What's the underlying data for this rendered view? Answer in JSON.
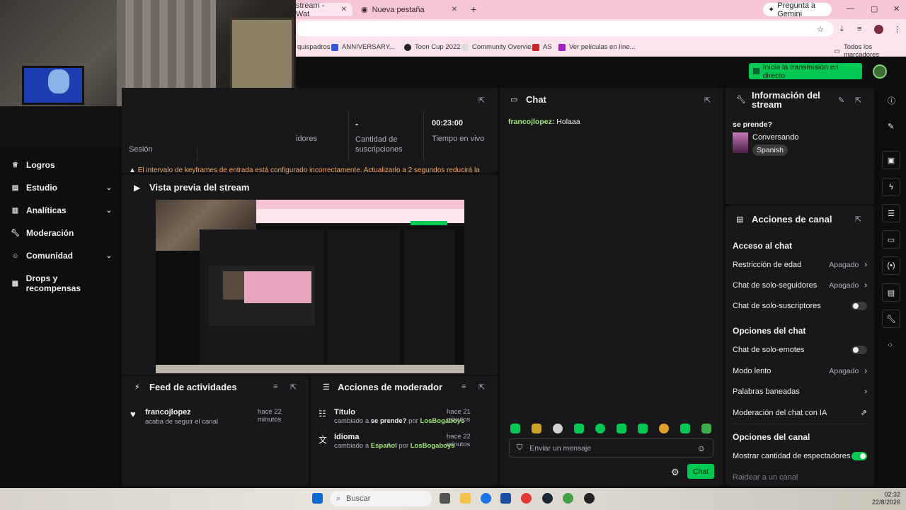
{
  "browser": {
    "tabs": [
      {
        "title": "stream - Wat",
        "active": true
      },
      {
        "title": "Nueva pestaña",
        "active": false
      }
    ],
    "gemini_label": "Pregunta a Gemini",
    "bookmarks": [
      "quispadros",
      "ANNIVERSARY...",
      "Toon Cup 2022",
      "Community Overvie...",
      "AS",
      "Ver películas en líne..."
    ],
    "all_bookmarks": "Todos los marcadores"
  },
  "header": {
    "go_live_label": "Inicia la transmisión en directo"
  },
  "stats": {
    "session_label": "Sesión",
    "followers_label": "idores",
    "subs_value": "-",
    "subs_label": "Cantidad de suscripciones",
    "live_time_value": "00:23:00",
    "live_time_label": "Tiempo en vivo",
    "warning": "El intervalo de keyframes de entrada está configurado incorrectamente. Actualizarlo a 2 segundos reducirá la"
  },
  "sidebar": {
    "items": [
      {
        "label": "Logros",
        "icon": "trophy-icon",
        "has_chevron": false
      },
      {
        "label": "Estudio",
        "icon": "studio-icon",
        "has_chevron": true
      },
      {
        "label": "Analíticas",
        "icon": "chart-icon",
        "has_chevron": true
      },
      {
        "label": "Moderación",
        "icon": "wrench-icon",
        "has_chevron": false
      },
      {
        "label": "Comunidad",
        "icon": "people-icon",
        "has_chevron": true
      },
      {
        "label": "Drops y recompensas",
        "icon": "gift-icon",
        "has_chevron": false
      }
    ]
  },
  "preview": {
    "title": "Vista previa del stream"
  },
  "chat": {
    "title": "Chat",
    "messages": [
      {
        "user": "francojlopez:",
        "text": "Holaaa"
      }
    ],
    "input_placeholder": "Enviar un mensaje",
    "send_label": "Chat"
  },
  "stream_info": {
    "title": "Información del stream",
    "stream_title": "se prende?",
    "category": "Conversando",
    "language": "Spanish"
  },
  "channel_actions": {
    "title": "Acciones de canal",
    "chat_access_heading": "Acceso al chat",
    "age_restriction": {
      "label": "Restricción de edad",
      "value": "Apagado"
    },
    "followers_only": {
      "label": "Chat de solo-seguidores",
      "value": "Apagado"
    },
    "subs_only": {
      "label": "Chat de solo-suscriptores"
    },
    "chat_options_heading": "Opciones del chat",
    "emotes_only": {
      "label": "Chat de solo-emotes"
    },
    "slow_mode": {
      "label": "Modo lento",
      "value": "Apagado"
    },
    "banned_words": {
      "label": "Palabras baneadas"
    },
    "ai_moderation": {
      "label": "Moderación del chat con IA"
    },
    "channel_options_heading": "Opciones del canal",
    "show_viewers": {
      "label": "Mostrar cantidad de espectadores"
    },
    "raid": {
      "label": "Raidear a un canal"
    }
  },
  "activity_feed": {
    "title": "Feed de actividades",
    "items": [
      {
        "user": "francojlopez",
        "action": "acaba de seguir el canal",
        "time": "hace 22 minutos"
      }
    ]
  },
  "mod_actions": {
    "title": "Acciones de moderador",
    "items": [
      {
        "field": "Título",
        "prefix": "cambiado a",
        "value": "se prende?",
        "by": "por",
        "actor": "LosBogaboys",
        "time": "hace 21 minutos"
      },
      {
        "field": "Idioma",
        "prefix": "cambiado a",
        "value": "Español",
        "by": "por",
        "actor": "LosBogaboys",
        "time": "hace 22 minutos"
      }
    ]
  },
  "taskbar": {
    "search_placeholder": "Buscar",
    "time": "02:32",
    "date": "22/8/2026"
  },
  "colors": {
    "accent_green": "#00c853",
    "username_green": "#9fe870",
    "panel_bg": "#18181b",
    "page_bg": "#0e0e10"
  }
}
